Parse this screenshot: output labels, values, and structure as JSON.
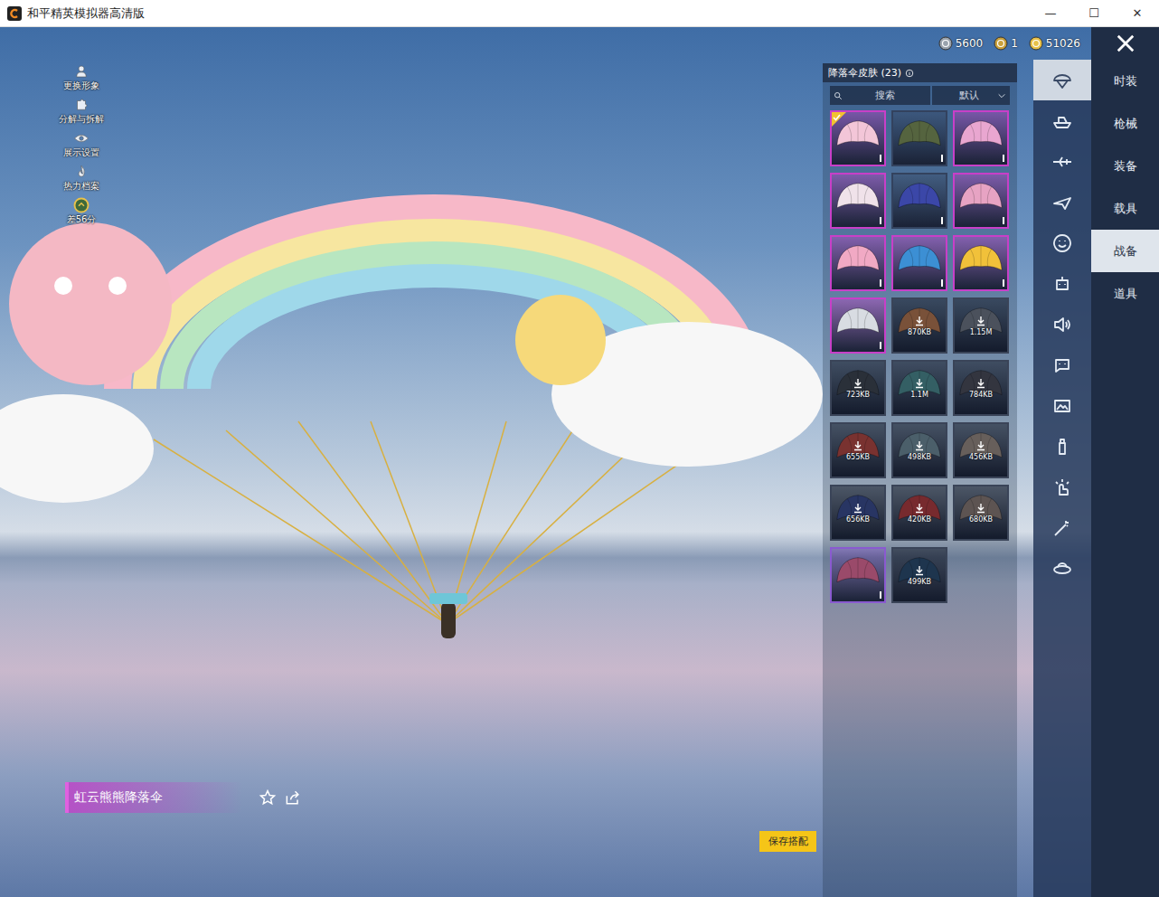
{
  "window": {
    "title": "和平精英模拟器高清版",
    "controls": [
      "—",
      "☐",
      "✕"
    ]
  },
  "currencies": [
    {
      "amount": "5600",
      "color": "#9aa3ad"
    },
    {
      "amount": "1",
      "color": "#c9a13b"
    },
    {
      "amount": "51026",
      "color": "#e8c14a"
    }
  ],
  "side_menu": [
    {
      "label": "更换形象"
    },
    {
      "label": "分解与拆解"
    },
    {
      "label": "展示设置"
    },
    {
      "label": "热力档案"
    }
  ],
  "level_badge": {
    "label": "差56分"
  },
  "panel": {
    "title": "降落伞皮肤 (23)",
    "search_placeholder": "搜索",
    "sort": "默认",
    "items": [
      {
        "kind": "owned",
        "selected": true,
        "color": "#c83fc8",
        "canopy": "#f3c6d8"
      },
      {
        "kind": "owned",
        "selected": false,
        "color": "#33425e",
        "canopy": "#55643f"
      },
      {
        "kind": "owned",
        "selected": false,
        "color": "#c83fc8",
        "canopy": "#e9a6d0"
      },
      {
        "kind": "owned",
        "selected": false,
        "color": "#c83fc8",
        "canopy": "#f0e2ea"
      },
      {
        "kind": "owned",
        "selected": false,
        "color": "#33425e",
        "canopy": "#3b47a8"
      },
      {
        "kind": "owned",
        "selected": false,
        "color": "#c83fc8",
        "canopy": "#e7a3c3"
      },
      {
        "kind": "owned",
        "selected": false,
        "color": "#c83fc8",
        "canopy": "#f1a9c4"
      },
      {
        "kind": "owned",
        "selected": false,
        "color": "#c83fc8",
        "canopy": "#3c8fd4"
      },
      {
        "kind": "owned",
        "selected": false,
        "color": "#c83fc8",
        "canopy": "#f1c13a"
      },
      {
        "kind": "owned",
        "selected": false,
        "color": "#c83fc8",
        "canopy": "#d8dce2"
      },
      {
        "kind": "download",
        "selected": false,
        "color": "#3a4458",
        "canopy": "#b5754a",
        "size": "870KB"
      },
      {
        "kind": "download",
        "selected": false,
        "color": "#3a4458",
        "canopy": "#6f7680",
        "size": "1.15M"
      },
      {
        "kind": "download",
        "selected": false,
        "color": "#3a4458",
        "canopy": "#3d424a",
        "size": "723KB"
      },
      {
        "kind": "download",
        "selected": false,
        "color": "#3a4458",
        "canopy": "#4c8a8c",
        "size": "1.1M"
      },
      {
        "kind": "download",
        "selected": false,
        "color": "#3a4458",
        "canopy": "#4a4a54",
        "size": "784KB"
      },
      {
        "kind": "download",
        "selected": false,
        "color": "#3a4458",
        "canopy": "#b5453c",
        "size": "655KB"
      },
      {
        "kind": "download",
        "selected": false,
        "color": "#3a4458",
        "canopy": "#6f8a96",
        "size": "498KB"
      },
      {
        "kind": "download",
        "selected": false,
        "color": "#3a4458",
        "canopy": "#9a8a7e",
        "size": "456KB"
      },
      {
        "kind": "download",
        "selected": false,
        "color": "#3a4458",
        "canopy": "#3a4a8a",
        "size": "656KB"
      },
      {
        "kind": "download",
        "selected": false,
        "color": "#3a4458",
        "canopy": "#b33a3a",
        "size": "420KB"
      },
      {
        "kind": "download",
        "selected": false,
        "color": "#3a4458",
        "canopy": "#8a7a70",
        "size": "680KB"
      },
      {
        "kind": "owned",
        "selected": false,
        "color": "#8a5ad0",
        "canopy": "#9a4a6a"
      },
      {
        "kind": "download",
        "selected": false,
        "color": "#3a4458",
        "canopy": "#2a4a6a",
        "size": "499KB"
      }
    ]
  },
  "featured": {
    "name": "虹云熊熊降落伞"
  },
  "save_button": "保存搭配",
  "icon_tabs": [
    {
      "selected": true
    },
    {
      "selected": false
    },
    {
      "selected": false
    },
    {
      "selected": false
    },
    {
      "selected": false
    },
    {
      "selected": false
    },
    {
      "selected": false
    },
    {
      "selected": false
    },
    {
      "selected": false
    },
    {
      "selected": false
    },
    {
      "selected": false
    },
    {
      "selected": false
    },
    {
      "selected": false
    }
  ],
  "categories": [
    {
      "label": "时装",
      "selected": false
    },
    {
      "label": "枪械",
      "selected": false
    },
    {
      "label": "装备",
      "selected": false
    },
    {
      "label": "载具",
      "selected": false
    },
    {
      "label": "战备",
      "selected": true
    },
    {
      "label": "道具",
      "selected": false
    }
  ]
}
